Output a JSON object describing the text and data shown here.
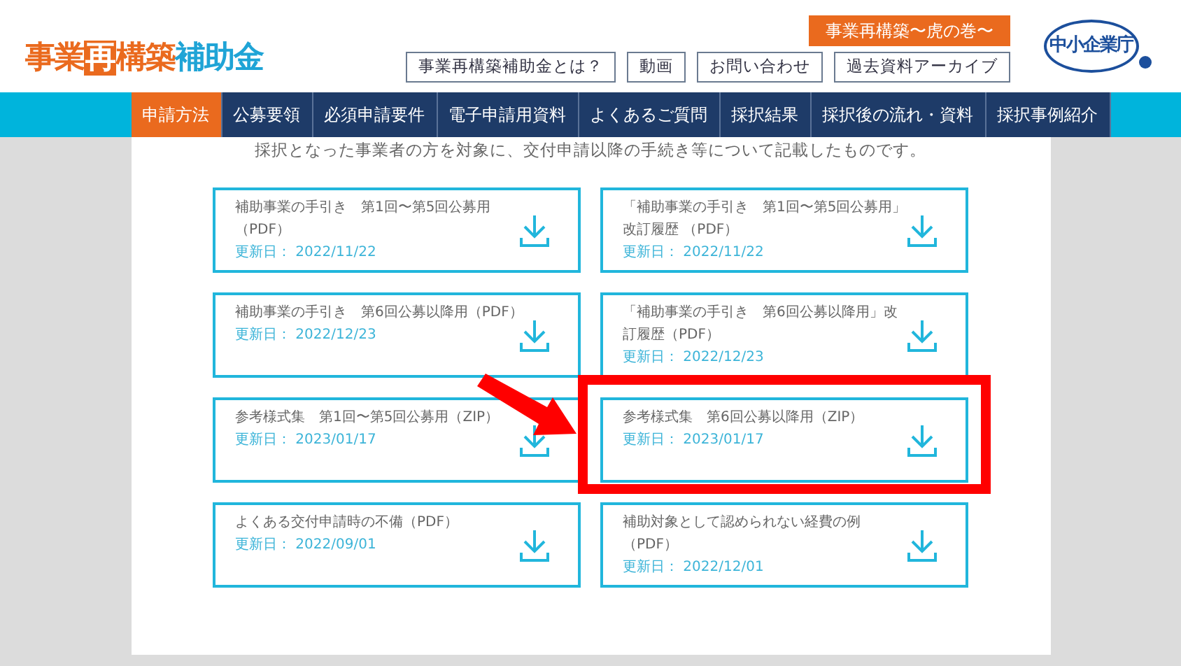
{
  "logo": {
    "lead": "事業",
    "boxed": "再",
    "mid": "構築",
    "tail": "補助金"
  },
  "series_tag": "事業再構築〜虎の巻〜",
  "header_links": [
    "事業再構築補助金とは？",
    "動画",
    "お問い合わせ",
    "過去資料アーカイブ"
  ],
  "agency_logo": "中小企業庁",
  "nav": [
    {
      "label": "申請方法",
      "selected": true
    },
    {
      "label": "公募要領",
      "selected": false
    },
    {
      "label": "必須申請要件",
      "selected": false
    },
    {
      "label": "電子申請用資料",
      "selected": false
    },
    {
      "label": "よくあるご質問",
      "selected": false
    },
    {
      "label": "採択結果",
      "selected": false
    },
    {
      "label": "採択後の流れ・資料",
      "selected": false
    },
    {
      "label": "採択事例紹介",
      "selected": false
    }
  ],
  "intro": "採択となった事業者の方を対象に、交付申請以降の手続き等について記載したものです。",
  "documents": [
    {
      "title": "補助事業の手引き　第1回〜第5回公募用（PDF）",
      "updated": "更新日： 2022/11/22",
      "highlighted": false
    },
    {
      "title": "「補助事業の手引き　第1回〜第5回公募用」改訂履歴 （PDF）",
      "updated": "更新日： 2022/11/22",
      "highlighted": false
    },
    {
      "title": "補助事業の手引き　第6回公募以降用（PDF）",
      "updated": "更新日： 2022/12/23",
      "highlighted": false
    },
    {
      "title": "「補助事業の手引き　第6回公募以降用」改訂履歴（PDF）",
      "updated": "更新日： 2022/12/23",
      "highlighted": false
    },
    {
      "title": "参考様式集　第1回〜第5回公募用（ZIP）",
      "updated": "更新日： 2023/01/17",
      "highlighted": false
    },
    {
      "title": "参考様式集　第6回公募以降用（ZIP）",
      "updated": "更新日： 2023/01/17",
      "highlighted": true
    },
    {
      "title": "よくある交付申請時の不備（PDF）",
      "updated": "更新日： 2022/09/01",
      "highlighted": false
    },
    {
      "title": "補助対象として認められない経費の例（PDF）",
      "updated": "更新日： 2022/12/01",
      "highlighted": false
    }
  ]
}
